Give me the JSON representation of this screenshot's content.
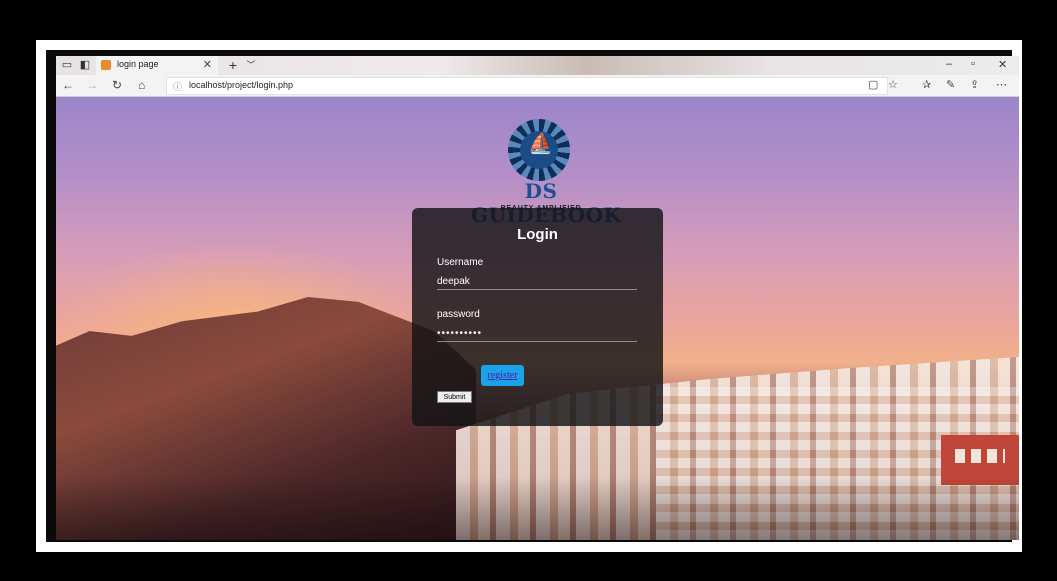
{
  "browser": {
    "tab_title": "login page",
    "url": "localhost/project/login.php"
  },
  "logo": {
    "brand": "DS GUIDEBOOK",
    "tagline": "BEAUTY AMPLIFIED"
  },
  "login": {
    "heading": "Login",
    "username_label": "Username",
    "username_value": "deepak",
    "password_label": "password",
    "password_value": "••••••••••",
    "register_label": "register",
    "submit_label": "Submit"
  },
  "colors": {
    "card_bg": "#141416",
    "register_bg": "#1aa3e8",
    "brand": "#1f4f8f"
  }
}
